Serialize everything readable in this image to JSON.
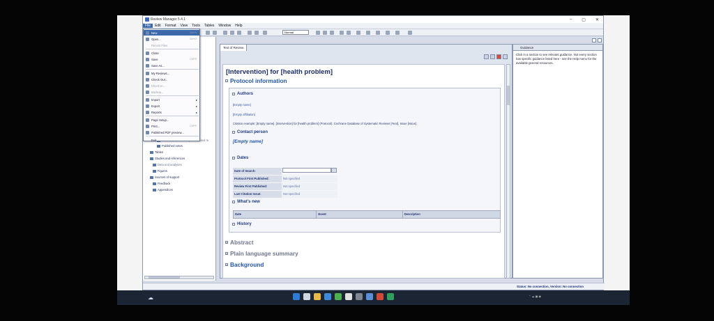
{
  "app": {
    "title": "Review Manager 5.4.1"
  },
  "menubar": [
    "File",
    "Edit",
    "Format",
    "View",
    "Tools",
    "Tables",
    "Window",
    "Help"
  ],
  "toolbar": {
    "style_combo": "Normal"
  },
  "file_menu": {
    "items": [
      {
        "label": "New",
        "shortcut": "Ctrl+N",
        "icon": "new-file-icon",
        "state": "selected"
      },
      {
        "label": "Open...",
        "shortcut": "Ctrl+O",
        "icon": "open-folder-icon",
        "state": "normal"
      },
      {
        "label": "Recent Files",
        "shortcut": "",
        "icon": "",
        "state": "dim"
      },
      {
        "label": "Close",
        "shortcut": "",
        "icon": "close-doc-icon",
        "state": "normal"
      },
      {
        "label": "Save",
        "shortcut": "Ctrl+S",
        "icon": "save-icon",
        "state": "normal"
      },
      {
        "label": "Save As...",
        "shortcut": "",
        "icon": "save-as-icon",
        "state": "normal"
      },
      {
        "label": "My Reviews...",
        "shortcut": "",
        "icon": "my-reviews-icon",
        "state": "normal"
      },
      {
        "label": "Check Out...",
        "shortcut": "",
        "icon": "check-out-icon",
        "state": "normal"
      },
      {
        "label": "Check In...",
        "shortcut": "",
        "icon": "check-in-icon",
        "state": "dim"
      },
      {
        "label": "Backup...",
        "shortcut": "",
        "icon": "backup-icon",
        "state": "dim"
      },
      {
        "label": "Import",
        "shortcut": "",
        "icon": "import-icon",
        "state": "submenu"
      },
      {
        "label": "Export",
        "shortcut": "",
        "icon": "export-icon",
        "state": "submenu"
      },
      {
        "label": "Reports",
        "shortcut": "",
        "icon": "reports-icon",
        "state": "submenu"
      },
      {
        "label": "Page Setup...",
        "shortcut": "",
        "icon": "page-setup-icon",
        "state": "normal"
      },
      {
        "label": "Print...",
        "shortcut": "Ctrl+P",
        "icon": "print-icon",
        "state": "normal"
      },
      {
        "label": "Published PDF preview...",
        "shortcut": "",
        "icon": "pdf-preview-icon",
        "state": "normal"
      },
      {
        "label": "Exit",
        "shortcut": "",
        "icon": "",
        "state": "normal"
      }
    ]
  },
  "tree": [
    {
      "label": "Differences between protocol and re",
      "dim": true
    },
    {
      "label": "Published notes",
      "dim": false
    },
    {
      "label": "Tables",
      "dim": false
    },
    {
      "label": "Studies and references",
      "dim": false
    },
    {
      "label": "Data and analyses",
      "dim": true
    },
    {
      "label": "Figures",
      "dim": false
    },
    {
      "label": "Sources of support",
      "dim": false
    },
    {
      "label": "Feedback",
      "dim": false
    },
    {
      "label": "Appendices",
      "dim": false
    }
  ],
  "doc": {
    "tab": "Text of Review",
    "title": "[Intervention] for [health problem]",
    "protocol_info": "Protocol information",
    "authors": "Authors",
    "empty_name_field": "[Empty name]",
    "empty_affiliation": "[Empty affiliation]",
    "citation": "Citation example: [Empty name]. [Intervention] for [health problem] (Protocol). Cochrane Database of Systematic Reviews [Year], Issue [Issue].",
    "contact_person": "Contact person",
    "contact_name": "[Empty name]",
    "dates": "Dates",
    "date_rows": [
      {
        "label": "Date of Search:",
        "value": ""
      },
      {
        "label": "Protocol First Published:",
        "value": "Not specified"
      },
      {
        "label": "Review First Published:",
        "value": "Not specified"
      },
      {
        "label": "Last Citation Issue:",
        "value": "Not specified"
      }
    ],
    "whats_new": "What's new",
    "whats_new_cols": [
      "Date",
      "Event",
      "Description"
    ],
    "history": "History",
    "abstract": "Abstract",
    "plain_language": "Plain language summary",
    "background": "Background"
  },
  "guidance": {
    "tab": "Guidance",
    "text": "Click in a section to see relevant guidance. Not every section has specific guidance listed here - see the Help menu for the available general resources."
  },
  "status": {
    "text": "Status: No connection, Version: No connection"
  }
}
